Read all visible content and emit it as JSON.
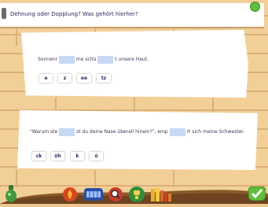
{
  "header": {
    "title": "Dehnung oder Dopplung? Was gehört hierher?"
  },
  "exercise1": {
    "parts": [
      "Sonnenr",
      "me schü",
      "t unsere Haut."
    ],
    "options": [
      "e",
      "z",
      "ee",
      "tz"
    ]
  },
  "exercise2": {
    "parts": [
      "\"Warum ste",
      "st du deine Nase überall hinein?\", emp",
      "rt sich meine Schwester."
    ],
    "options": [
      "ck",
      "öh",
      "k",
      "ö"
    ]
  },
  "toolbar": {
    "icons": [
      "bottle-icon",
      "fire-icon",
      "keyboard-icon",
      "magnifier-icon",
      "trophy-icon",
      "books-icon",
      "check-button"
    ]
  }
}
